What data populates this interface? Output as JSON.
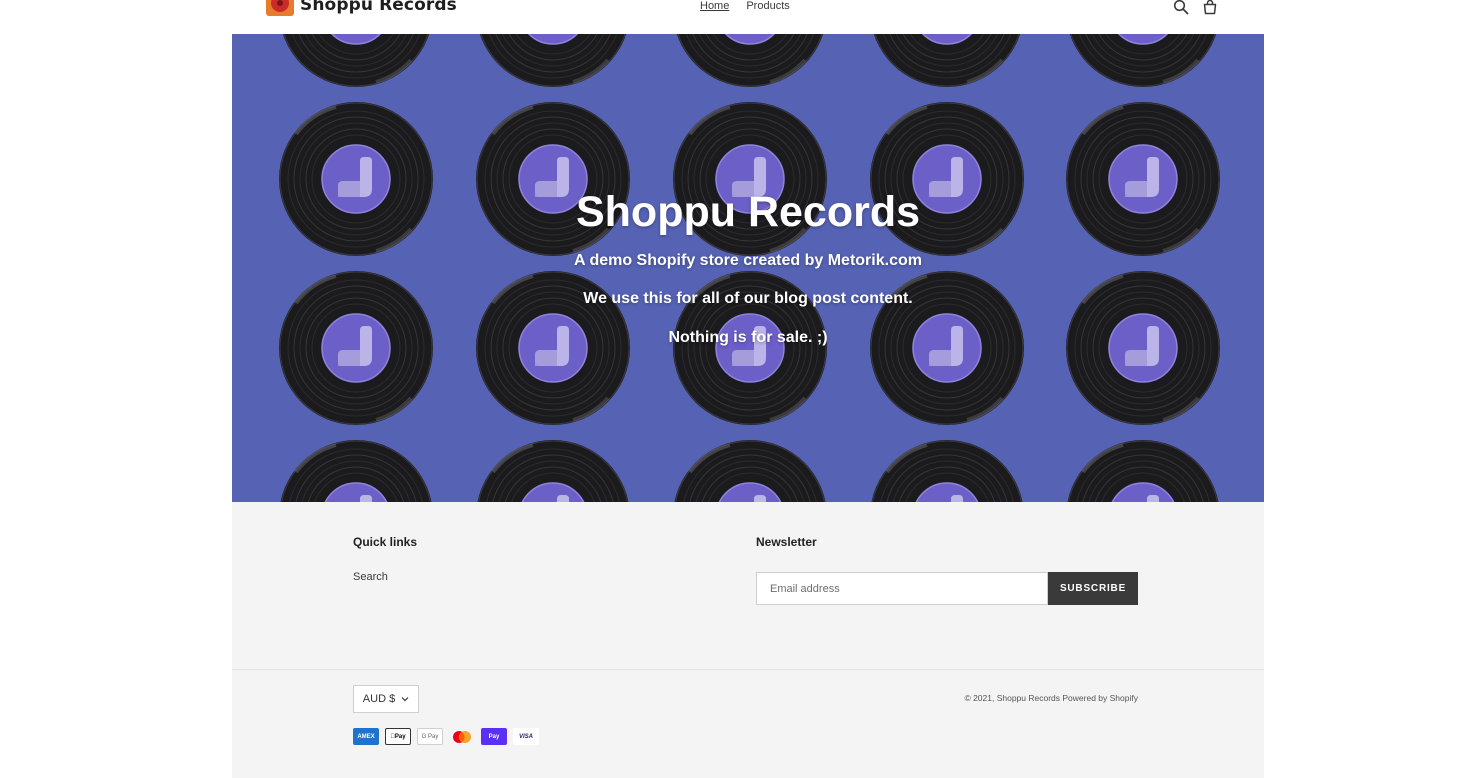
{
  "header": {
    "store_name": "Shoppu Records",
    "nav": [
      {
        "label": "Home",
        "active": true
      },
      {
        "label": "Products",
        "active": false
      }
    ],
    "icons": [
      "search-icon",
      "cart-icon"
    ]
  },
  "hero": {
    "title": "Shoppu Records",
    "lines": [
      "A demo Shopify store created by Metorik.com",
      "We use this for all of our blog post content.",
      "Nothing is for sale. ;)"
    ],
    "background_color": "#5663b5"
  },
  "footer": {
    "quick_links": {
      "heading": "Quick links",
      "items": [
        "Search"
      ]
    },
    "newsletter": {
      "heading": "Newsletter",
      "email_placeholder": "Email address",
      "button_label": "SUBSCRIBE"
    },
    "currency": {
      "selected": "AUD $"
    },
    "copyright": "© 2021, Shoppu Records Powered by Shopify",
    "payment_methods": [
      {
        "name": "amex-icon",
        "label": "AMEX"
      },
      {
        "name": "apple-pay-icon",
        "label": "Pay"
      },
      {
        "name": "google-pay-icon",
        "label": "G Pay"
      },
      {
        "name": "mastercard-icon",
        "label": ""
      },
      {
        "name": "shop-pay-icon",
        "label": "Pay"
      },
      {
        "name": "visa-icon",
        "label": "VISA"
      }
    ]
  }
}
